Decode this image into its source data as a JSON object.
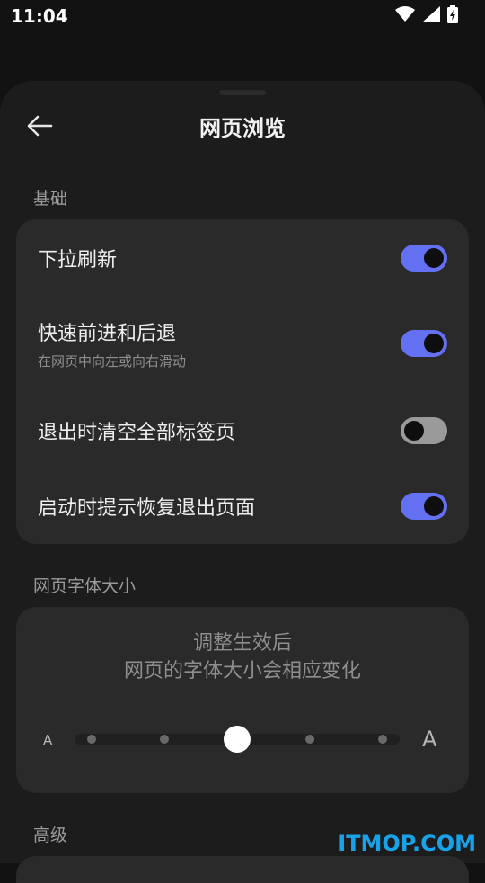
{
  "status_bar": {
    "time": "11:04",
    "icons": [
      "wifi-icon",
      "signal-icon",
      "battery-charging-icon"
    ]
  },
  "header": {
    "back_icon": "arrow-left-icon",
    "title": "网页浏览"
  },
  "sections": {
    "basic": {
      "label": "基础",
      "items": [
        {
          "title": "下拉刷新",
          "subtitle": "",
          "enabled": true
        },
        {
          "title": "快速前进和后退",
          "subtitle": "在网页中向左或向右滑动",
          "enabled": true
        },
        {
          "title": "退出时清空全部标签页",
          "subtitle": "",
          "enabled": false
        },
        {
          "title": "启动时提示恢复退出页面",
          "subtitle": "",
          "enabled": true
        }
      ]
    },
    "font_size": {
      "label": "网页字体大小",
      "hint_line1": "调整生效后",
      "hint_line2": "网页的字体大小会相应变化",
      "small_label": "A",
      "large_label": "A",
      "steps": 5,
      "selected_step": 3
    },
    "advanced": {
      "label": "高级"
    }
  },
  "colors": {
    "accent": "#6470f2",
    "background": "#1c1c1c",
    "card": "#2a2a2a"
  },
  "watermark": "ITMOP.COM"
}
